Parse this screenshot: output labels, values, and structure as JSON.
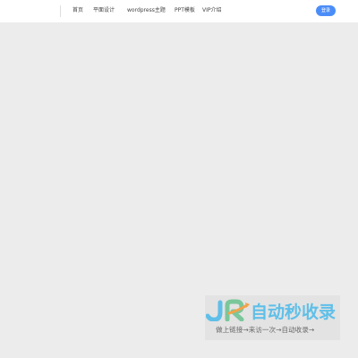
{
  "nav": {
    "items": [
      "首页",
      "平面设计",
      "wordpress主题",
      "PPT模板",
      "VIP介绍"
    ]
  },
  "login_label": "登录",
  "watermark": {
    "logo_text": "JR",
    "title": "自动秒收录",
    "subtitle": "做上链接→来访一次→自动收录→",
    "color": "#5fbfe8"
  },
  "colors": {
    "accent": "#4b8df8",
    "background": "#ececec",
    "topbar": "#ffffff"
  }
}
